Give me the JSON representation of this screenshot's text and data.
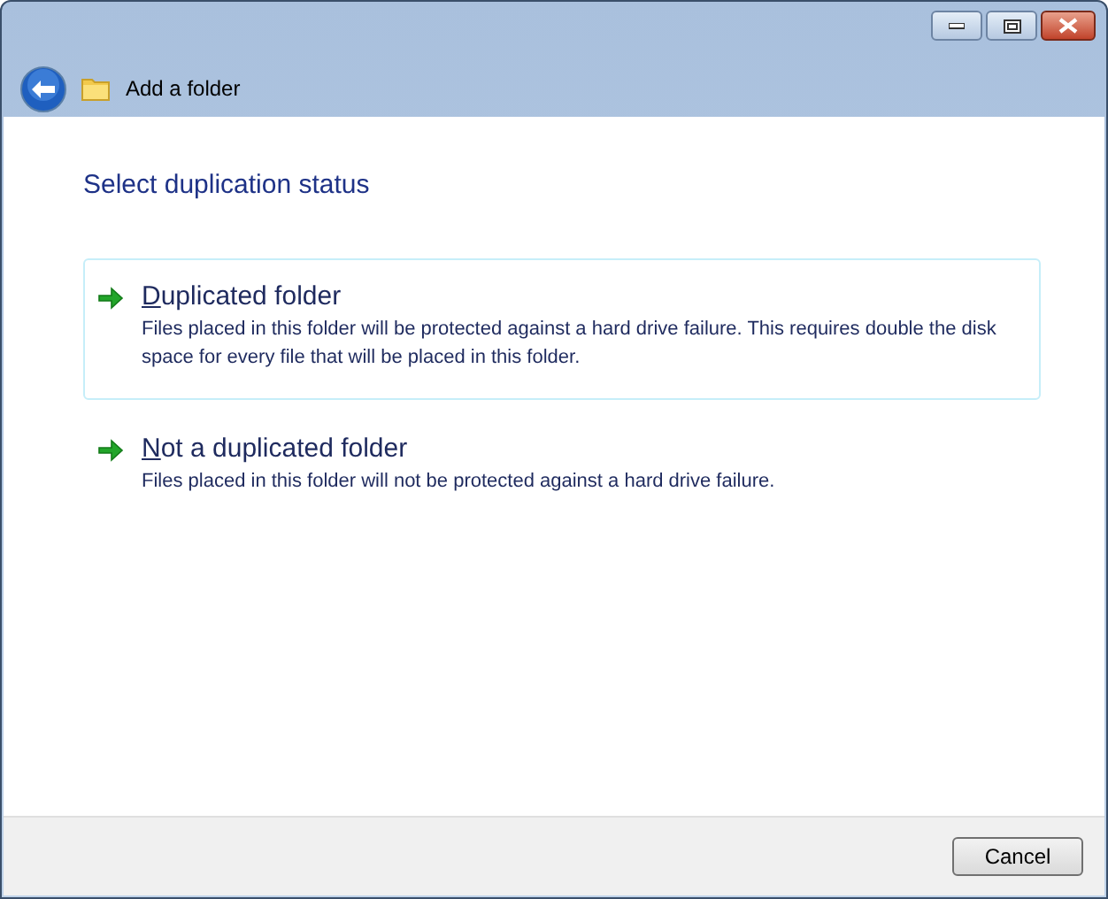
{
  "window": {
    "title": "Add a folder"
  },
  "heading": "Select duplication status",
  "options": [
    {
      "title": "Duplicated folder",
      "description": "Files placed in this folder will be protected against a hard drive failure. This requires double the disk space for every file that will be placed in this folder.",
      "selected": true
    },
    {
      "title": "Not a duplicated folder",
      "description": "Files placed in this folder will not be protected against a hard drive failure.",
      "selected": false
    }
  ],
  "buttons": [
    "Cancel"
  ]
}
